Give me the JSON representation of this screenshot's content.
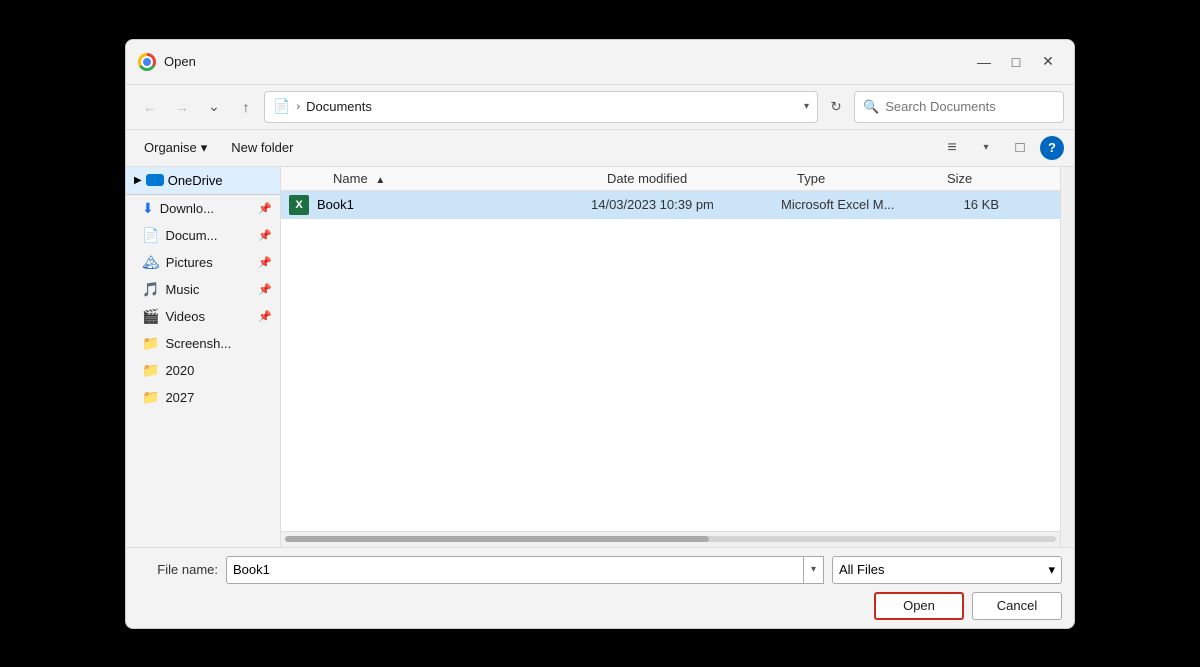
{
  "dialog": {
    "title": "Open",
    "close_label": "✕",
    "minimize_label": "—",
    "maximize_label": "□"
  },
  "nav": {
    "back_label": "←",
    "forward_label": "→",
    "down_label": "⌄",
    "up_label": "↑",
    "address_icon": "📄",
    "address_path": "Documents",
    "address_separator": ">",
    "refresh_label": "↻",
    "search_placeholder": "Search Documents"
  },
  "toolbar": {
    "organise_label": "Organise",
    "organise_arrow": "▾",
    "new_folder_label": "New folder",
    "view_list_label": "≡",
    "view_pane_label": "□",
    "help_label": "?"
  },
  "sidebar": {
    "onedrive_label": "OneDrive",
    "items": [
      {
        "icon": "↓",
        "label": "Downlo...",
        "icon_class": "icon-dl"
      },
      {
        "icon": "📄",
        "label": "Docum...",
        "icon_class": "icon-doc"
      },
      {
        "icon": "🏔",
        "label": "Pictures",
        "icon_class": "icon-pic"
      },
      {
        "icon": "🎵",
        "label": "Music",
        "icon_class": "icon-music"
      },
      {
        "icon": "🎬",
        "label": "Videos",
        "icon_class": "icon-video"
      },
      {
        "icon": "📁",
        "label": "Screensh...",
        "icon_class": "icon-folder"
      },
      {
        "icon": "📁",
        "label": "2020",
        "icon_class": "icon-folder"
      },
      {
        "icon": "📁",
        "label": "2027",
        "icon_class": "icon-folder"
      }
    ]
  },
  "file_list": {
    "columns": [
      {
        "label": "Name",
        "sort_arrow": "▲"
      },
      {
        "label": "Date modified",
        "sort_arrow": ""
      },
      {
        "label": "Type",
        "sort_arrow": ""
      },
      {
        "label": "Size",
        "sort_arrow": ""
      }
    ],
    "files": [
      {
        "name": "Book1",
        "date": "14/03/2023 10:39 pm",
        "type": "Microsoft Excel M...",
        "size": "16 KB",
        "selected": true
      }
    ]
  },
  "footer": {
    "filename_label": "File name:",
    "filename_value": "Book1",
    "filetype_value": "All Files",
    "open_label": "Open",
    "cancel_label": "Cancel"
  }
}
